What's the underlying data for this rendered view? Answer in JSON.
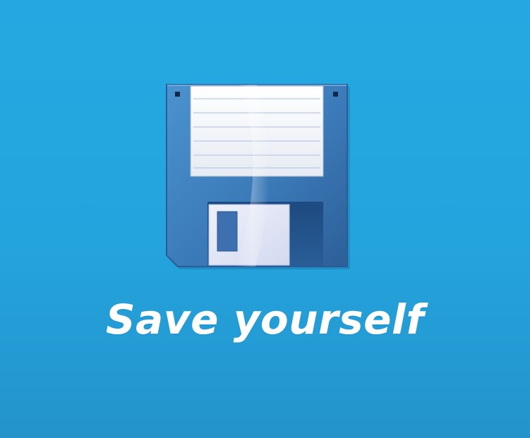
{
  "caption": "Save yourself",
  "icon": {
    "name": "floppy-disk-icon"
  },
  "colors": {
    "background": "#25a8e1",
    "disk_body": "#3a7fc0",
    "label": "#f4f6fa",
    "caption_text": "#ffffff"
  }
}
